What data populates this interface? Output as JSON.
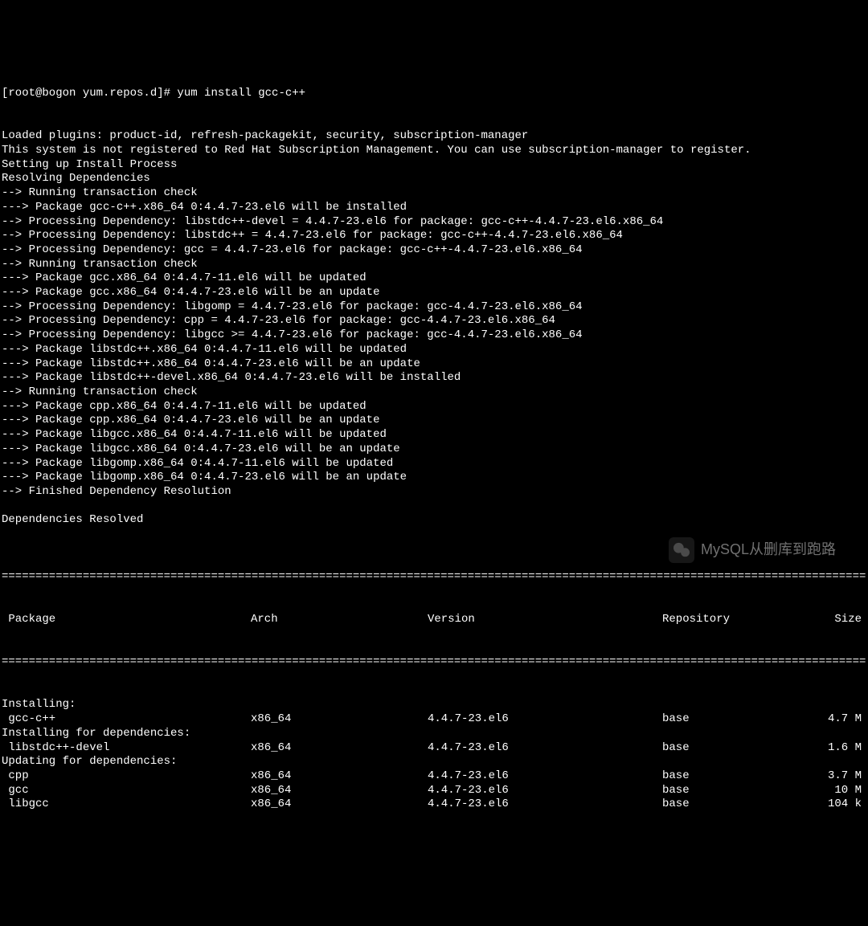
{
  "prompt": "[root@bogon yum.repos.d]# yum install gcc-c++",
  "lines": [
    "Loaded plugins: product-id, refresh-packagekit, security, subscription-manager",
    "This system is not registered to Red Hat Subscription Management. You can use subscription-manager to register.",
    "Setting up Install Process",
    "Resolving Dependencies",
    "--> Running transaction check",
    "---> Package gcc-c++.x86_64 0:4.4.7-23.el6 will be installed",
    "--> Processing Dependency: libstdc++-devel = 4.4.7-23.el6 for package: gcc-c++-4.4.7-23.el6.x86_64",
    "--> Processing Dependency: libstdc++ = 4.4.7-23.el6 for package: gcc-c++-4.4.7-23.el6.x86_64",
    "--> Processing Dependency: gcc = 4.4.7-23.el6 for package: gcc-c++-4.4.7-23.el6.x86_64",
    "--> Running transaction check",
    "---> Package gcc.x86_64 0:4.4.7-11.el6 will be updated",
    "---> Package gcc.x86_64 0:4.4.7-23.el6 will be an update",
    "--> Processing Dependency: libgomp = 4.4.7-23.el6 for package: gcc-4.4.7-23.el6.x86_64",
    "--> Processing Dependency: cpp = 4.4.7-23.el6 for package: gcc-4.4.7-23.el6.x86_64",
    "--> Processing Dependency: libgcc >= 4.4.7-23.el6 for package: gcc-4.4.7-23.el6.x86_64",
    "---> Package libstdc++.x86_64 0:4.4.7-11.el6 will be updated",
    "---> Package libstdc++.x86_64 0:4.4.7-23.el6 will be an update",
    "---> Package libstdc++-devel.x86_64 0:4.4.7-23.el6 will be installed",
    "--> Running transaction check",
    "---> Package cpp.x86_64 0:4.4.7-11.el6 will be updated",
    "---> Package cpp.x86_64 0:4.4.7-23.el6 will be an update",
    "---> Package libgcc.x86_64 0:4.4.7-11.el6 will be updated",
    "---> Package libgcc.x86_64 0:4.4.7-23.el6 will be an update",
    "---> Package libgomp.x86_64 0:4.4.7-11.el6 will be updated",
    "---> Package libgomp.x86_64 0:4.4.7-23.el6 will be an update",
    "--> Finished Dependency Resolution",
    "",
    "Dependencies Resolved",
    ""
  ],
  "divider": "================================================================================================================================",
  "headers": {
    "package": " Package",
    "arch": "Arch",
    "version": "Version",
    "repository": "Repository",
    "size": "Size"
  },
  "sections": [
    {
      "title": "Installing:",
      "rows": [
        {
          "pkg": " gcc-c++",
          "arch": "x86_64",
          "ver": "4.4.7-23.el6",
          "repo": "base",
          "size": "4.7 M"
        }
      ]
    },
    {
      "title": "Installing for dependencies:",
      "rows": [
        {
          "pkg": " libstdc++-devel",
          "arch": "x86_64",
          "ver": "4.4.7-23.el6",
          "repo": "base",
          "size": "1.6 M"
        }
      ]
    },
    {
      "title": "Updating for dependencies:",
      "rows": [
        {
          "pkg": " cpp",
          "arch": "x86_64",
          "ver": "4.4.7-23.el6",
          "repo": "base",
          "size": "3.7 M"
        },
        {
          "pkg": " gcc",
          "arch": "x86_64",
          "ver": "4.4.7-23.el6",
          "repo": "base",
          "size": "10 M"
        },
        {
          "pkg": " libgcc",
          "arch": "x86_64",
          "ver": "4.4.7-23.el6",
          "repo": "base",
          "size": "104 k"
        }
      ]
    }
  ],
  "watermark": "MySQL从删库到跑路"
}
